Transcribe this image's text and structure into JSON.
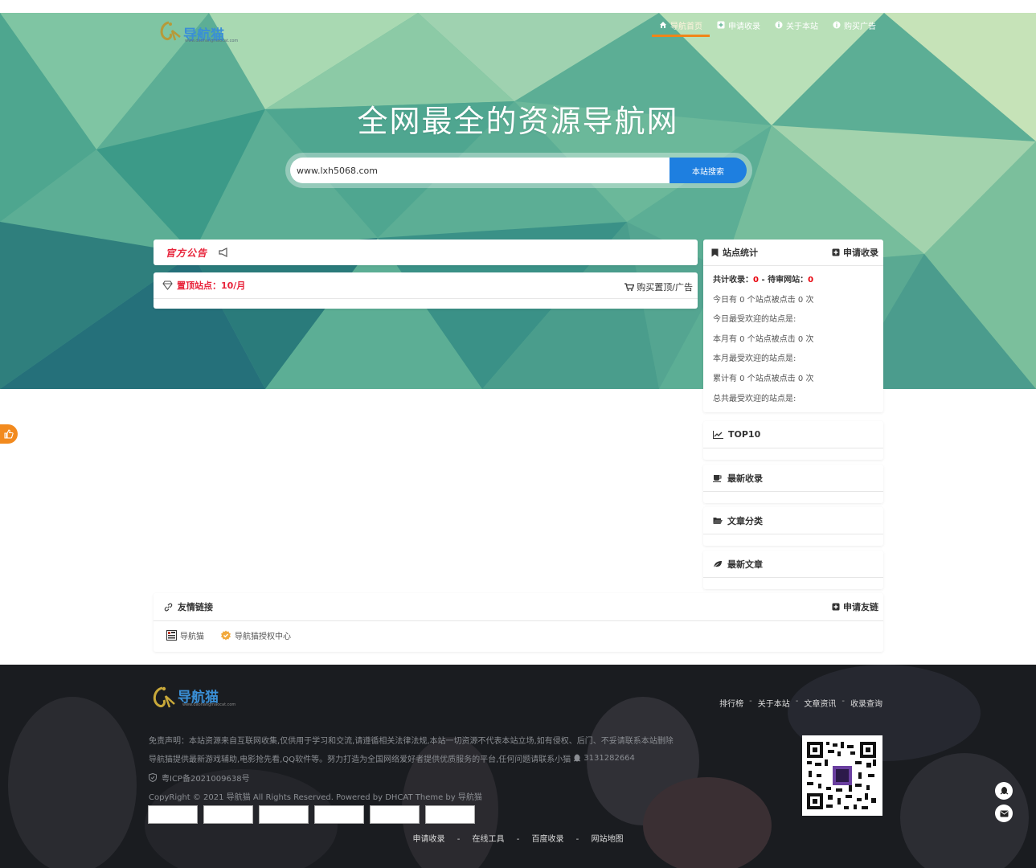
{
  "brand": {
    "logo_text": "导航猫",
    "logo_url": "www.daohangmaocat.com"
  },
  "nav": {
    "items": [
      {
        "label": "导航首页",
        "icon": "home-icon"
      },
      {
        "label": "申请收录",
        "icon": "plus-square-icon"
      },
      {
        "label": "关于本站",
        "icon": "info-circle-icon"
      },
      {
        "label": "购买广告",
        "icon": "info-circle-icon"
      }
    ]
  },
  "hero": {
    "title": "全网最全的资源导航网",
    "search_value": "www.lxh5068.com",
    "search_button": "本站搜索"
  },
  "notice": {
    "tag": "官方公告"
  },
  "pin": {
    "label": "置顶站点：10/月",
    "buy": "购买置顶/广告"
  },
  "stats": {
    "title": "站点统计",
    "apply": "申请收录",
    "total_label": "共计收录：",
    "total_value": "0",
    "sep": " - ",
    "pending_label": "待审网站：",
    "pending_value": "0",
    "lines": [
      "今日有 0 个站点被点击 0 次",
      "今日最受欢迎的站点是:",
      "本月有 0 个站点被点击 0 次",
      "本月最受欢迎的站点是:",
      "累计有 0 个站点被点击 0 次",
      "总共最受欢迎的站点是:"
    ]
  },
  "side": {
    "top10": "TOP10",
    "latest_sites": "最新收录",
    "article_categories": "文章分类",
    "latest_articles": "最新文章"
  },
  "links": {
    "title": "友情链接",
    "apply": "申请友链",
    "items": [
      "导航猫",
      "导航猫授权中心"
    ]
  },
  "footer": {
    "logo_text": "导航猫",
    "logo_url": "www.daohangmaocat.com",
    "nav": [
      "排行榜",
      "关于本站",
      "文章资讯",
      "收录查询"
    ],
    "nav_sep": "-",
    "disclaimer": "免责声明：本站资源来自互联网收集,仅供用于学习和交流,请遵循相关法律法规,本站一切资源不代表本站立场,如有侵权、后门、不妥请联系本站删除",
    "intro": "导航猫提供最新游戏辅助,电影抢先看,QQ软件等。努力打造为全国网络爱好者提供优质服务的平台,任何问题请联系小猫",
    "qq": "3131282664",
    "icp": "粤ICP备2021009638号",
    "copyright": "CopyRight © 2021 导航猫 All Rights Reserved. Powered by DHCAT Theme by 导航猫",
    "bottom_links": [
      "申请收录",
      "在线工具",
      "百度收录",
      "网站地图"
    ],
    "bottom_sep": "-"
  },
  "colors": {
    "accent": "#1e7fe0",
    "active_nav": "#f08519",
    "alert_red": "#e8243b",
    "float_orange": "#f28a1e"
  }
}
